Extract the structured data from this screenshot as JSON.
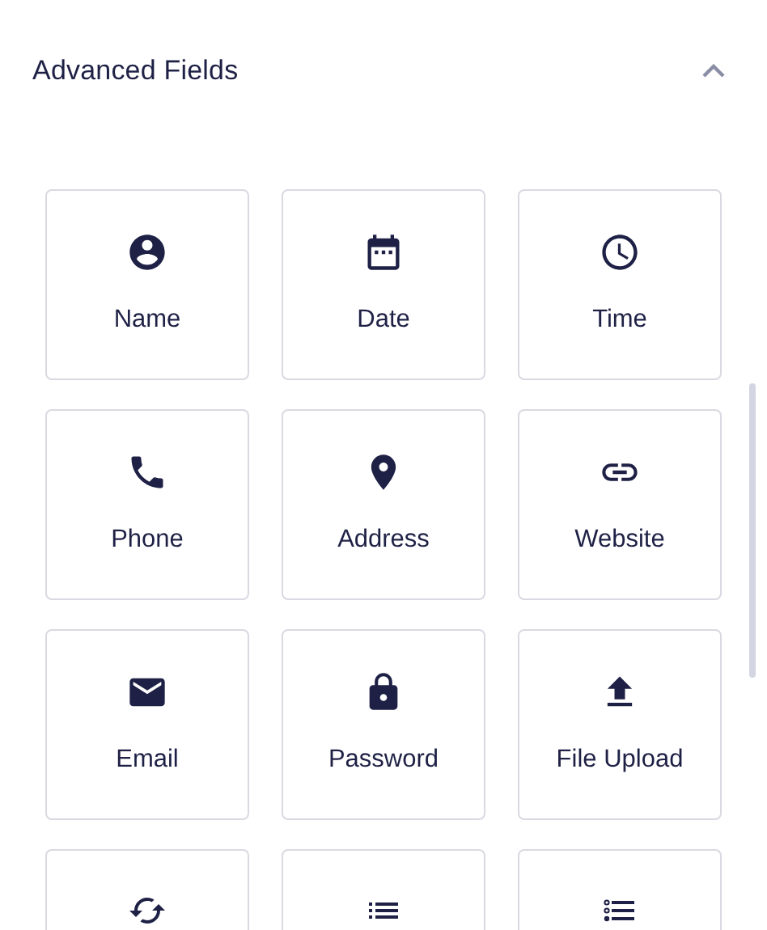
{
  "section": {
    "title": "Advanced Fields",
    "expanded": true
  },
  "fields": [
    {
      "label": "Name"
    },
    {
      "label": "Date"
    },
    {
      "label": "Time"
    },
    {
      "label": "Phone"
    },
    {
      "label": "Address"
    },
    {
      "label": "Website"
    },
    {
      "label": "Email"
    },
    {
      "label": "Password"
    },
    {
      "label": "File Upload"
    },
    {
      "cut_off": true
    },
    {
      "cut_off": true
    },
    {
      "cut_off": true
    }
  ]
}
